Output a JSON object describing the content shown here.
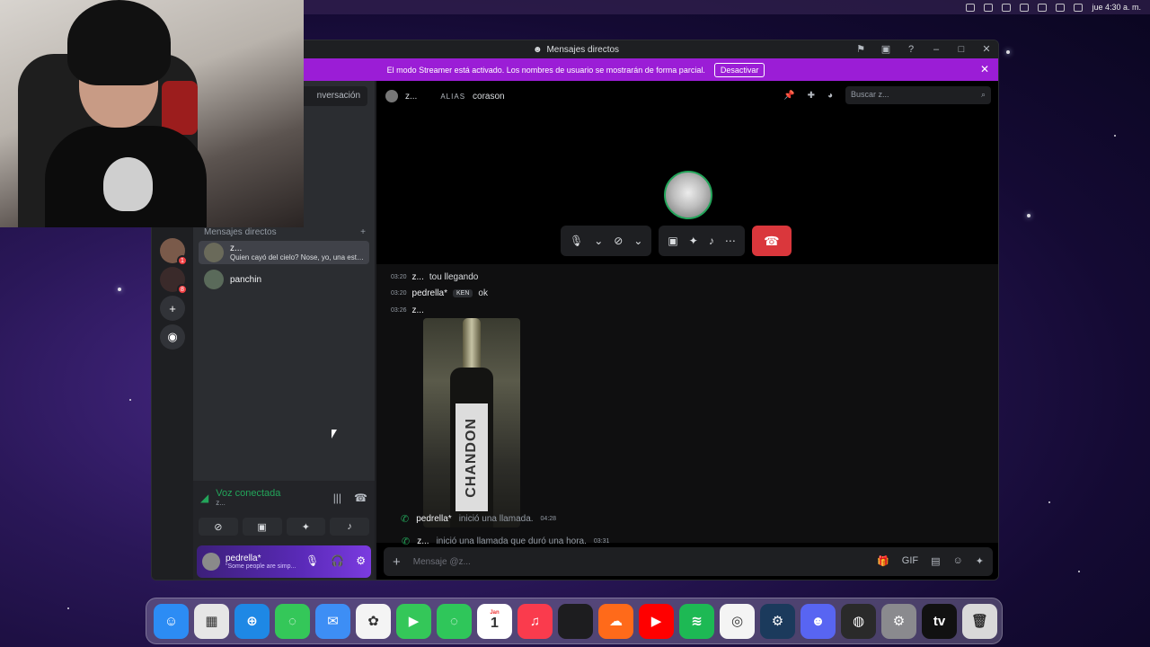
{
  "menubar": {
    "clock": "jue 4:30 a. m."
  },
  "window": {
    "title": "Mensajes directos",
    "streamer_banner": "El modo Streamer está activado. Los nombres de usuario se mostrarán de forma parcial.",
    "streamer_button": "Desactivar"
  },
  "sidebar": {
    "search_placeholder": "nversación",
    "dm_header": "Mensajes directos",
    "dms": [
      {
        "name": "z...",
        "subtitle": "Quien cayó del cielo? Nose, yo, una estre..."
      },
      {
        "name": "panchin",
        "subtitle": ""
      }
    ],
    "rail_badges": [
      "1",
      "8"
    ]
  },
  "voice": {
    "status": "Voz conectada",
    "channel": "z..."
  },
  "user": {
    "name": "pedrella*",
    "status": "\"Some people are simp..."
  },
  "chat": {
    "header_name": "z...",
    "alias_label": "ALIAS",
    "alias_value": "corason",
    "search_placeholder": "Buscar z...",
    "messages": [
      {
        "time": "03:20",
        "author": "z...",
        "tag": "",
        "text": "tou llegando"
      },
      {
        "time": "03:20",
        "author": "pedrella*",
        "tag": "KEN",
        "text": "ok"
      },
      {
        "time": "03:26",
        "author": "z...",
        "tag": "",
        "text": ""
      }
    ],
    "photo_label": "CHANDON",
    "system_messages": [
      {
        "who": "z...",
        "text": "inició una llamada que duró una hora.",
        "time": "03:31"
      },
      {
        "who": "pedrella*",
        "text": "inició una llamada.",
        "time": "04:28"
      }
    ],
    "composer_placeholder": "Mensaje @z..."
  },
  "dock": {
    "apps": [
      {
        "name": "finder",
        "color": "#2c8cf4",
        "glyph": "☺"
      },
      {
        "name": "launchpad",
        "color": "#e6e6e6",
        "glyph": "▦"
      },
      {
        "name": "safari",
        "color": "#1e88e5",
        "glyph": "⊕"
      },
      {
        "name": "messages",
        "color": "#34c759",
        "glyph": "◌"
      },
      {
        "name": "mail",
        "color": "#3d8ef5",
        "glyph": "✉"
      },
      {
        "name": "photos",
        "color": "#f4f4f4",
        "glyph": "✿"
      },
      {
        "name": "facetime",
        "color": "#34c759",
        "glyph": "▶"
      },
      {
        "name": "messages-2",
        "color": "#2fc65a",
        "glyph": "◌"
      },
      {
        "name": "calendar",
        "color": "#ffffff",
        "glyph": "1"
      },
      {
        "name": "music",
        "color": "#fa3b4d",
        "glyph": "♫"
      },
      {
        "name": "apple-app",
        "color": "#1d1d1f",
        "glyph": ""
      },
      {
        "name": "soundcloud",
        "color": "#ff6a1a",
        "glyph": "☁"
      },
      {
        "name": "youtube",
        "color": "#ff0000",
        "glyph": "▶"
      },
      {
        "name": "spotify",
        "color": "#1db954",
        "glyph": "≋"
      },
      {
        "name": "chrome",
        "color": "#f4f4f4",
        "glyph": "◎"
      },
      {
        "name": "steam",
        "color": "#1b3a5c",
        "glyph": "⚙"
      },
      {
        "name": "discord",
        "color": "#5865f2",
        "glyph": "☻"
      },
      {
        "name": "obs",
        "color": "#2a2a2a",
        "glyph": "◍"
      },
      {
        "name": "system-settings",
        "color": "#8a8a8e",
        "glyph": "⚙"
      },
      {
        "name": "apple-tv",
        "color": "#111111",
        "glyph": "tv"
      },
      {
        "name": "trash",
        "color": "#d9d9d9",
        "glyph": "🗑"
      }
    ],
    "calendar_month": "Jan"
  }
}
